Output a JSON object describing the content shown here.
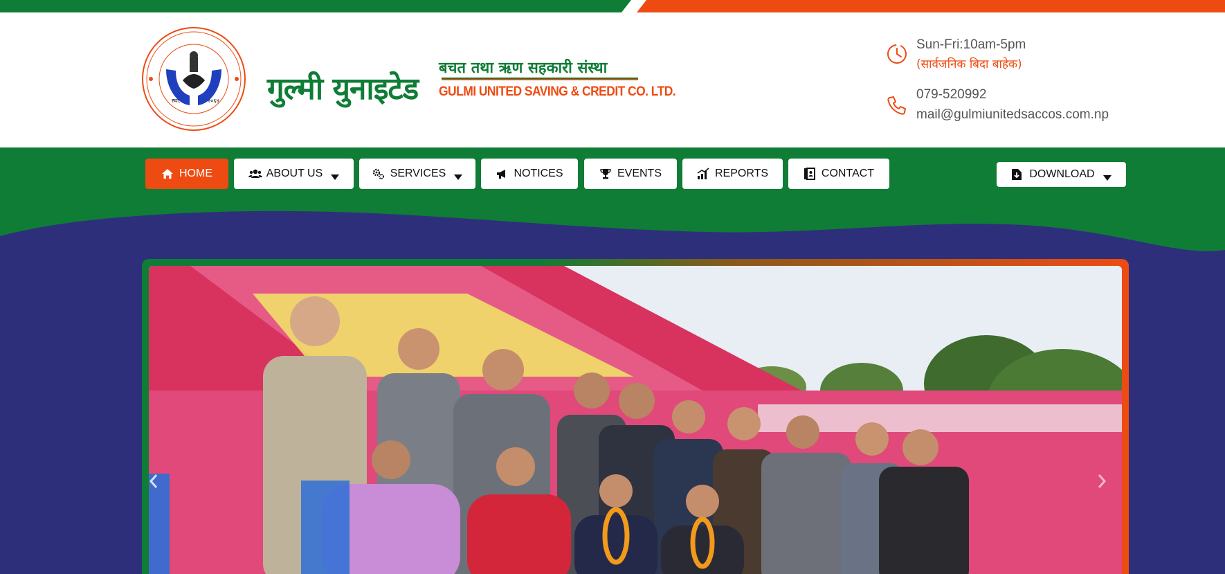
{
  "site": {
    "name_np": "गुल्मी युनाइटेड",
    "tagline_np": "बचत तथा ऋण सहकारी संस्था",
    "name_en": "GULMI UNITED SAVING & CREDIT CO. LTD.",
    "logo_alt": "Gulmi United Saving & Co-operative Ltd. seal"
  },
  "contact": {
    "hours": "Sun-Fri:10am-5pm",
    "hours_note": "(सार्वजनिक बिदा बाहेक)",
    "phone": "079-520992",
    "email": "mail@gulmiunitedsaccos.com.np"
  },
  "nav": {
    "items": [
      {
        "label": "HOME",
        "icon": "home-icon",
        "dropdown": false,
        "active": true
      },
      {
        "label": "ABOUT US",
        "icon": "users-icon",
        "dropdown": true,
        "active": false
      },
      {
        "label": "SERVICES",
        "icon": "gears-icon",
        "dropdown": true,
        "active": false
      },
      {
        "label": "NOTICES",
        "icon": "megaphone-icon",
        "dropdown": false,
        "active": false
      },
      {
        "label": "EVENTS",
        "icon": "trophy-icon",
        "dropdown": false,
        "active": false
      },
      {
        "label": "REPORTS",
        "icon": "chart-icon",
        "dropdown": false,
        "active": false
      },
      {
        "label": "CONTACT",
        "icon": "contact-book-icon",
        "dropdown": false,
        "active": false
      }
    ],
    "download": {
      "label": "DOWNLOAD",
      "icon": "file-download-icon",
      "dropdown": true
    }
  },
  "slider": {
    "prev_icon": "chevron-left-icon",
    "next_icon": "chevron-right-icon"
  },
  "colors": {
    "brand_green": "#0f7d35",
    "brand_orange": "#ee4b12",
    "navy": "#2e2f7a"
  }
}
